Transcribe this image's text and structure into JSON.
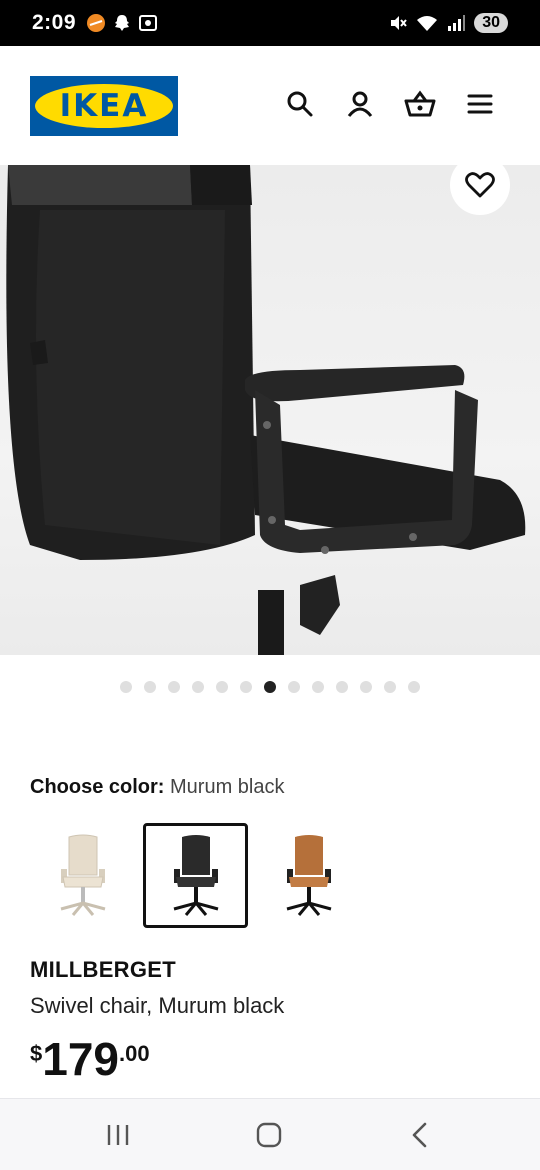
{
  "status_bar": {
    "time": "2:09",
    "battery": "30"
  },
  "header": {
    "logo_text": "IKEA",
    "icons": [
      "search-icon",
      "profile-icon",
      "basket-icon",
      "menu-icon"
    ]
  },
  "gallery": {
    "image": "black office swivel chair, rear view",
    "dot_count": 13,
    "active_index": 6
  },
  "color_picker": {
    "label": "Choose color:",
    "selected_value": "Murum black",
    "options": [
      {
        "name": "beige",
        "color": "#e6dccb"
      },
      {
        "name": "black",
        "color": "#2a2a2a"
      },
      {
        "name": "brown",
        "color": "#b5703a"
      }
    ],
    "selected_index": 1
  },
  "product": {
    "name": "MILLBERGET",
    "description": "Swivel chair, Murum black",
    "price_currency": "$",
    "price_integer": "179",
    "price_decimal": ".00"
  },
  "colors": {
    "ikea_blue": "#0058a3",
    "ikea_yellow": "#ffdb00"
  }
}
